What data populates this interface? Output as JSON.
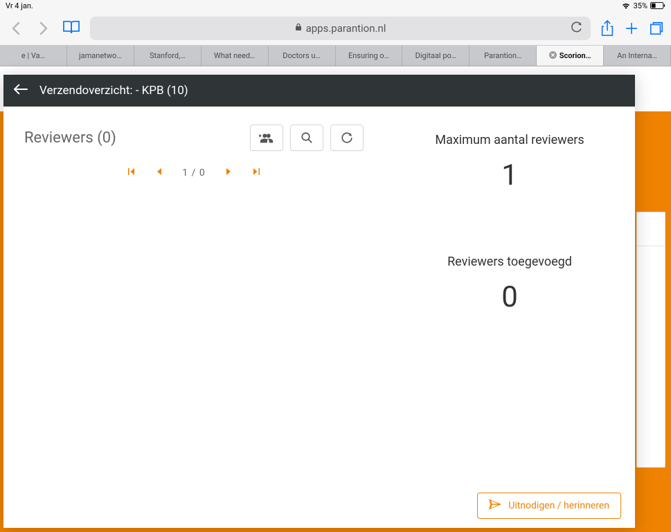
{
  "status": {
    "time_label": "Vr 4 jan.",
    "battery_percent": "35%"
  },
  "browser": {
    "url_host": "apps.parantion.nl"
  },
  "tabs": [
    {
      "label": "e | Va…"
    },
    {
      "label": "jamanetwo…"
    },
    {
      "label": "Stanford,…"
    },
    {
      "label": "What need…"
    },
    {
      "label": "Doctors u…"
    },
    {
      "label": "Ensuring o…"
    },
    {
      "label": "Digitaal po…"
    },
    {
      "label": "Parantion…"
    },
    {
      "label": "Scorion…",
      "active": true
    },
    {
      "label": "An Interna…"
    }
  ],
  "modal": {
    "title": "Verzendoverzicht: - KPB (10)",
    "reviewers_title": "Reviewers (0)",
    "pagination_label": "1 / 0",
    "stats": {
      "max_reviewers_label": "Maximum aantal reviewers",
      "max_reviewers_value": "1",
      "reviewers_added_label": "Reviewers toegevoegd",
      "reviewers_added_value": "0"
    },
    "invite_button": "Uitnodigen / herinneren"
  }
}
